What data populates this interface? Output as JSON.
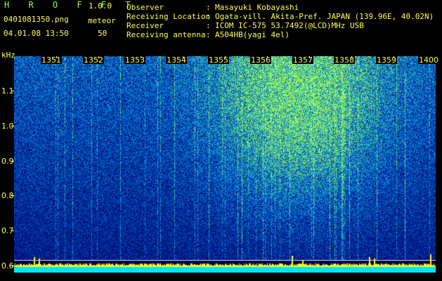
{
  "header": {
    "brand": "H R O F F T",
    "version": "1.0.0",
    "filename": "0401081350.png",
    "meteor_label": "meteor",
    "datetime": "04.01.08 13:50",
    "meteor_count": "50"
  },
  "info": [
    {
      "key": "Observer",
      "colon": ":",
      "value": "Masayuki Kobayashi"
    },
    {
      "key": "Receiving Location",
      "colon": ":",
      "value": "Ogata-vill. Akita-Pref. JAPAN (139.96E, 40.02N)"
    },
    {
      "key": "Receiver",
      "colon": ":",
      "value": "ICOM IC-575 53.7492(@LCD)MHz USB"
    },
    {
      "key": "Receiving antenna",
      "colon": ":",
      "value": "A504HB(yagi 4el)"
    }
  ],
  "axis": {
    "y_unit": "kHz",
    "y_ticks": [
      "1.1",
      "1.0",
      "0.9",
      "0.8",
      "0.7",
      "0.6"
    ],
    "x_ticks": [
      "1351",
      "1352",
      "1353",
      "1354",
      "1355",
      "1356",
      "1357",
      "1358",
      "1359",
      "1400"
    ]
  },
  "colors": {
    "background": "#000000",
    "label": "#ffff55",
    "brand": "#9cff3a",
    "signal_low": "#0a1a6e",
    "signal_mid": "#1f6fd0",
    "signal_high": "#8cff5a",
    "level_bar": "#ffff00",
    "level_base": "#00e5ff"
  }
}
